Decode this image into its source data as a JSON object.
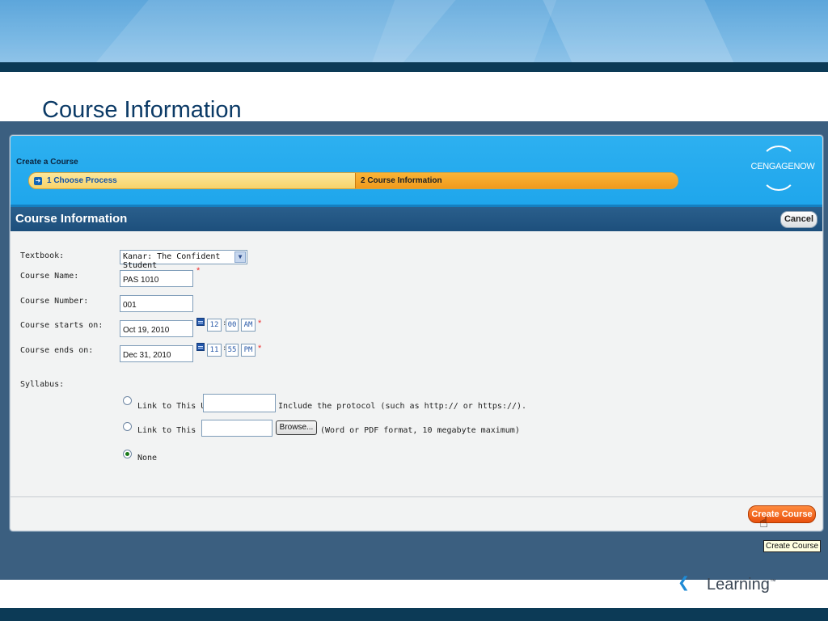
{
  "slide": {
    "title": "Course Information",
    "footer_brand": "Learning",
    "footer_tm": "™"
  },
  "wizard": {
    "title": "Create a Course",
    "step1_icon": "➜",
    "step1_label": "1 Choose Process",
    "step2_label": "2 Course Information",
    "brand": "CENGAGENOW"
  },
  "section": {
    "title": "Course Information",
    "cancel_label": "Cancel"
  },
  "form": {
    "textbook_label": "Textbook:",
    "textbook_value": "Kanar: The Confident Student",
    "course_name_label": "Course Name:",
    "course_name_value": "PAS 1010",
    "course_number_label": "Course Number:",
    "course_number_value": "001",
    "starts_label": "Course starts on:",
    "starts_date": "Oct 19, 2010",
    "starts_hour": "12",
    "starts_minute": "00",
    "starts_ampm": "AM",
    "ends_label": "Course ends on:",
    "ends_date": "Dec 31, 2010",
    "ends_hour": "11",
    "ends_minute": "55",
    "ends_ampm": "PM",
    "required_mark": "*",
    "time_separator": ":",
    "syllabus_label": "Syllabus:",
    "link_url_label": "Link to This URL:",
    "link_url_hint": "Include the protocol (such as http:// or https://).",
    "link_file_label": "Link to This File:",
    "browse_label": "Browse...",
    "link_file_hint": "(Word or PDF format, 10 megabyte maximum)",
    "none_label": "None",
    "selected_option": "None"
  },
  "footer": {
    "create_label": "Create Course",
    "tooltip": "Create Course"
  },
  "colors": {
    "header_blue": "#2db0f0",
    "section_blue": "#1d4f7c",
    "progress_orange": "#f09a1c",
    "create_orange": "#e8500d"
  }
}
